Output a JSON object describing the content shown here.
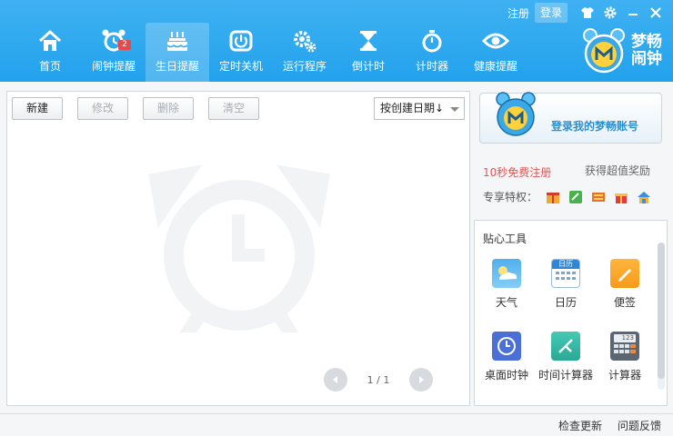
{
  "header": {
    "register_link": "注册",
    "login_link": "登录",
    "nav": [
      {
        "label": "首页",
        "icon": "home-icon"
      },
      {
        "label": "闹钟提醒",
        "icon": "alarm-clock-icon",
        "badge": "2"
      },
      {
        "label": "生日提醒",
        "icon": "birthday-cake-icon",
        "active": true
      },
      {
        "label": "定时关机",
        "icon": "power-icon"
      },
      {
        "label": "运行程序",
        "icon": "gears-icon"
      },
      {
        "label": "倒计时",
        "icon": "hourglass-icon"
      },
      {
        "label": "计时器",
        "icon": "stopwatch-icon"
      },
      {
        "label": "健康提醒",
        "icon": "eye-icon"
      }
    ],
    "brand": {
      "line1": "梦畅",
      "line2": "闹钟"
    }
  },
  "toolbar": {
    "new_label": "新建",
    "edit_label": "修改",
    "delete_label": "删除",
    "clear_label": "清空",
    "sort_label": "按创建日期↓"
  },
  "pager": {
    "text": "1 / 1"
  },
  "account": {
    "login_prompt": "登录我的梦畅账号",
    "free_register": "10秒免费注册",
    "reward": "获得超值奖励",
    "privileges_label": "专享特权："
  },
  "tools": {
    "title": "贴心工具",
    "items": [
      {
        "label": "天气",
        "icon": "weather-icon"
      },
      {
        "label": "日历",
        "icon": "calendar-icon",
        "icon_text": "日历"
      },
      {
        "label": "便签",
        "icon": "note-icon"
      },
      {
        "label": "桌面时钟",
        "icon": "desktop-clock-icon"
      },
      {
        "label": "时间计算器",
        "icon": "time-calculator-icon"
      },
      {
        "label": "计算器",
        "icon": "calculator-icon",
        "icon_text": "123"
      }
    ]
  },
  "status": {
    "check_update": "检查更新",
    "feedback": "问题反馈"
  },
  "colors": {
    "header": "#2aa6ee",
    "link_red": "#e25555",
    "login_blue": "#2b8fd0"
  }
}
